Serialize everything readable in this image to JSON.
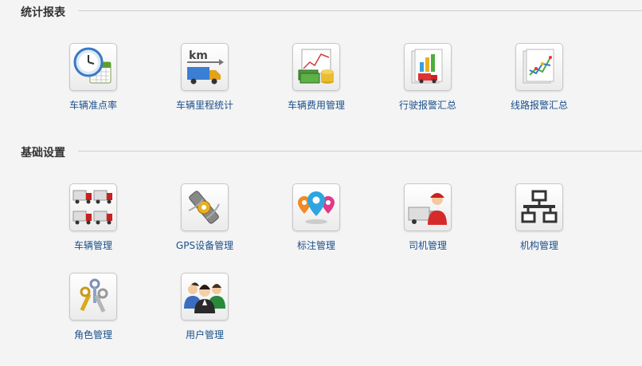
{
  "sections": [
    {
      "title": "统计报表",
      "items": [
        {
          "label": "车辆准点率",
          "icon": "clock-calendar-icon"
        },
        {
          "label": "车辆里程统计",
          "icon": "truck-km-icon"
        },
        {
          "label": "车辆费用管理",
          "icon": "money-chart-icon"
        },
        {
          "label": "行驶报警汇总",
          "icon": "truck-report-icon"
        },
        {
          "label": "线路报警汇总",
          "icon": "line-chart-report-icon"
        }
      ]
    },
    {
      "title": "基础设置",
      "items": [
        {
          "label": "车辆管理",
          "icon": "trucks-icon"
        },
        {
          "label": "GPS设备管理",
          "icon": "gps-device-icon"
        },
        {
          "label": "标注管理",
          "icon": "map-pins-icon"
        },
        {
          "label": "司机管理",
          "icon": "driver-icon"
        },
        {
          "label": "机构管理",
          "icon": "org-chart-icon"
        },
        {
          "label": "角色管理",
          "icon": "keys-icon"
        },
        {
          "label": "用户管理",
          "icon": "users-icon"
        }
      ]
    }
  ],
  "colors": {
    "label": "#1b4f8a",
    "section_title": "#333333",
    "background": "#f4f4f4"
  }
}
